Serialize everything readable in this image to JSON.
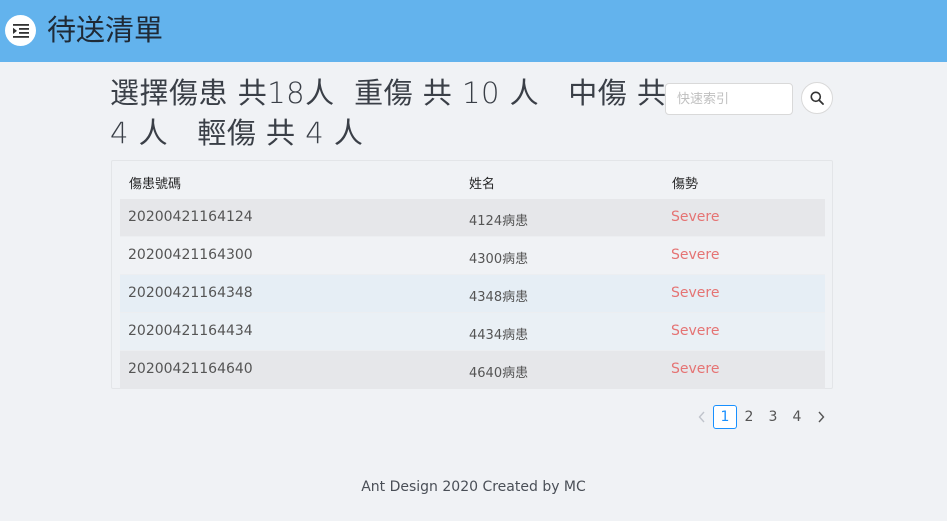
{
  "header": {
    "menu_icon": "menu-fold-icon",
    "title": "待送清單"
  },
  "summary": {
    "line1_a": "選擇傷患 共18人",
    "line1_b": "重傷 共 10 人",
    "line1_c": "中傷 共",
    "line2_a": "4 人",
    "line2_b": "輕傷 共 4 人"
  },
  "search": {
    "placeholder": "快速索引",
    "value": "",
    "icon": "search-icon"
  },
  "table": {
    "columns": [
      "傷患號碼",
      "姓名",
      "傷勢"
    ],
    "rows": [
      {
        "id": "20200421164124",
        "name": "4124病患",
        "status": "Severe"
      },
      {
        "id": "20200421164300",
        "name": "4300病患",
        "status": "Severe"
      },
      {
        "id": "20200421164348",
        "name": "4348病患",
        "status": "Severe"
      },
      {
        "id": "20200421164434",
        "name": "4434病患",
        "status": "Severe"
      },
      {
        "id": "20200421164640",
        "name": "4640病患",
        "status": "Severe"
      }
    ]
  },
  "pagination": {
    "pages": [
      "1",
      "2",
      "3",
      "4"
    ],
    "current": "1",
    "prev_icon": "chevron-left-icon",
    "next_icon": "chevron-right-icon"
  },
  "colors": {
    "header_bg": "#63b3ed",
    "status_severe": "#e57373",
    "accent": "#1890ff"
  },
  "footer": {
    "text": "Ant Design 2020 Created by MC"
  }
}
